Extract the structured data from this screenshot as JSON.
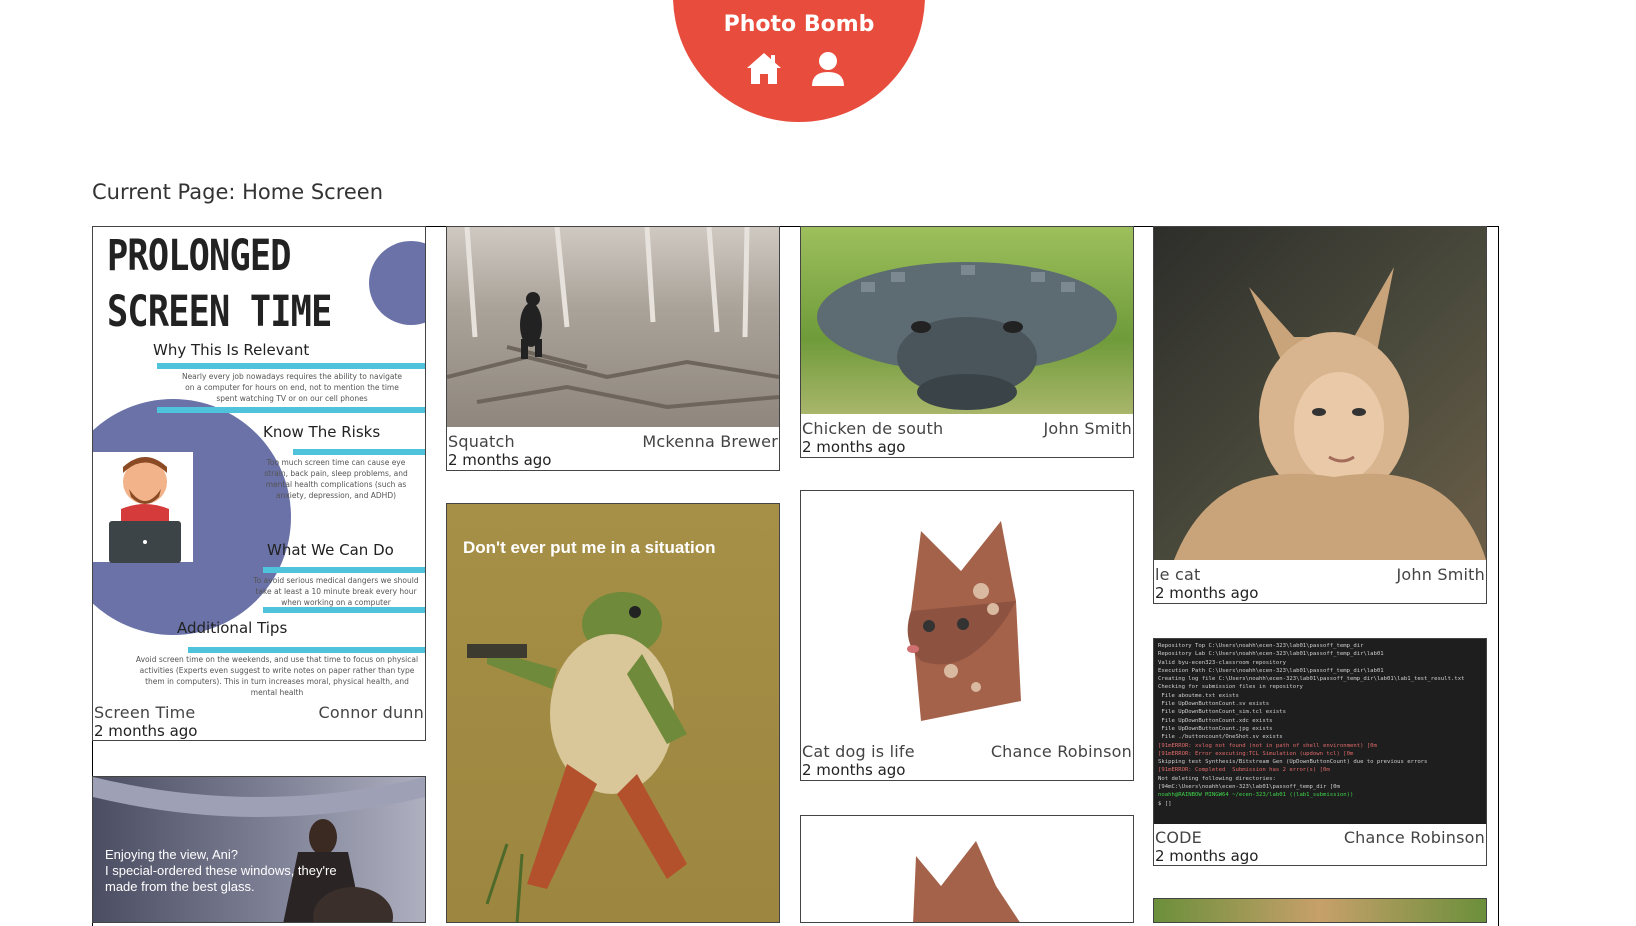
{
  "app": {
    "brand": "Photo Bomb"
  },
  "nav": {
    "home_icon": "home-icon",
    "profile_icon": "user-icon"
  },
  "page": {
    "current_label": "Current Page: Home Screen"
  },
  "posts": [
    {
      "title": "Screen Time",
      "author": "Connor dunn",
      "time": "2 months ago",
      "poster": {
        "heading1": "PROLONGED",
        "heading2": "SCREEN TIME",
        "s1": "Why This Is Relevant",
        "s1_text": "Nearly every job nowadays requires the ability to navigate on a computer for hours on end, not to mention the time spent watching TV or on our cell phones",
        "s2": "Know The Risks",
        "s2_text": "Too much screen time can cause eye strain, back pain, sleep problems, and mental health complications (such as anxiety, depression, and ADHD)",
        "s3": "What We Can Do",
        "s3_text": "To avoid serious medical dangers we should take at least a 10 minute break every hour when working on a computer",
        "s4": "Additional Tips",
        "s4_text": "Avoid screen time on the weekends, and use that time to focus on physical activities (Experts even suggest to write notes on paper rather than type them in computers). This in turn increases moral, physical health, and mental health"
      }
    },
    {
      "title": "Squatch",
      "author": "Mckenna Brewer",
      "time": "2 months ago"
    },
    {
      "title": "Chicken de south",
      "author": "John Smith",
      "time": "2 months ago"
    },
    {
      "title": "le cat",
      "author": "John Smith",
      "time": "2 months ago"
    },
    {
      "title": "Cat dog is life",
      "author": "Chance Robinson",
      "time": "2 months ago"
    },
    {
      "title": "CODE",
      "author": "Chance Robinson",
      "time": "2 months ago",
      "terminal": [
        "Repository Top C:\\Users\\noahh\\ecen-323\\lab01\\passoff_temp_dir",
        "Repository Lab C:\\Users\\noahh\\ecen-323\\lab01\\passoff_temp_dir\\lab01",
        "Valid byu-ecen323-classroom repository",
        "Execution Path C:\\Users\\noahh\\ecen-323\\lab01\\passoff_temp_dir\\lab01",
        "Creating log file C:\\Users\\noahh\\ecen-323\\lab01\\passoff_temp_dir\\lab01\\lab1_test_result.txt",
        "Checking for submission files in repository",
        " File aboutme.txt exists",
        " File UpDownButtonCount.sv exists",
        " File UpDownButtonCount_sim.tcl exists",
        " File UpDownButtonCount.xdc exists",
        " File UpDownButtonCount.jpg exists",
        " File ./buttoncount/OneShot.sv exists",
        "[91mERROR: xvlog not found (not in path of shell environment) [0m",
        "[91mERROR: Error executing:TCL Simulation (updown tcl) [0m",
        "Skipping test Synthesis/Bitstream Gen (UpDownButtonCount) due to previous errors",
        "[91mERROR: Completed  Submission has 2 error(s) [0m",
        "Not deleting following directories:",
        "[94mC:\\Users\\noahh\\ecen-323\\lab01\\passoff_temp_dir [0m",
        "noahh@RAINBOW MINGW64 ~/ecen-323/lab01 ((lab1_submission))",
        "$ []"
      ]
    }
  ],
  "frog_caption": "Don't ever put me in a situation",
  "meme_caption": [
    "Enjoying the view, Ani?",
    "I special-ordered these windows, they're",
    "made from the best glass."
  ]
}
